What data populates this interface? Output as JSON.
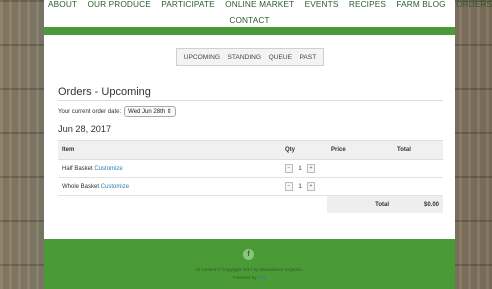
{
  "nav": {
    "items": [
      "ABOUT",
      "OUR PRODUCE",
      "PARTICIPATE",
      "ONLINE MARKET",
      "EVENTS",
      "RECIPES",
      "FARM BLOG",
      "ORDERS"
    ],
    "contact": "CONTACT"
  },
  "subnav": [
    "UPCOMING",
    "STANDING",
    "QUEUE",
    "PAST"
  ],
  "page_title": "Orders - Upcoming",
  "order_date": {
    "label": "Your current order date:",
    "selected": "Wed Jun 28th"
  },
  "date_heading": "Jun 28, 2017",
  "table": {
    "headers": [
      "Item",
      "Qty",
      "Price",
      "Total"
    ],
    "rows": [
      {
        "item": "Half Basket",
        "link": "Customize",
        "qty": "1"
      },
      {
        "item": "Whole Basket",
        "link": "Customize",
        "qty": "1"
      }
    ],
    "total_label": "Total",
    "total_value": "$0.00"
  },
  "footer": {
    "icon": "facebook-icon",
    "copyright": "All content © Copyright 2017 by Moondance Organics.",
    "powered_prefix": "Powered by",
    "powered_link": "Yola"
  },
  "colors": {
    "green": "#4a9a37",
    "link": "#2a7db7"
  }
}
